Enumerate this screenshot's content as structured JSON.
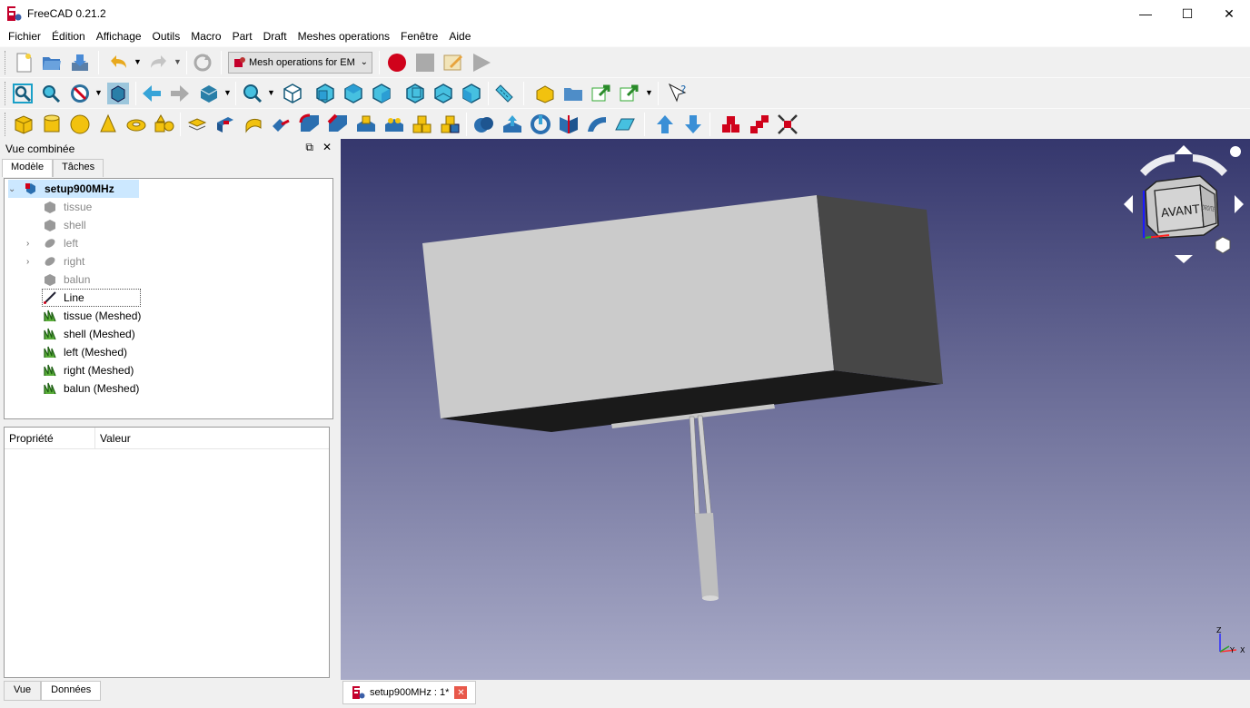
{
  "window": {
    "title": "FreeCAD 0.21.2",
    "min": "—",
    "max": "☐",
    "close": "✕"
  },
  "menu": [
    "Fichier",
    "Édition",
    "Affichage",
    "Outils",
    "Macro",
    "Part",
    "Draft",
    "Meshes operations",
    "Fenêtre",
    "Aide"
  ],
  "workbench": {
    "selected": "Mesh operations for EM"
  },
  "panel": {
    "title": "Vue combinée",
    "tabs": [
      "Modèle",
      "Tâches"
    ],
    "tree": [
      {
        "label": "setup900MHz",
        "kind": "doc"
      },
      {
        "label": "tissue",
        "kind": "box-hidden"
      },
      {
        "label": "shell",
        "kind": "box-hidden"
      },
      {
        "label": "left",
        "kind": "cyl-hidden",
        "expandable": true
      },
      {
        "label": "right",
        "kind": "cyl-hidden",
        "expandable": true
      },
      {
        "label": "balun",
        "kind": "box-hidden"
      },
      {
        "label": "Line",
        "kind": "line"
      },
      {
        "label": "tissue (Meshed)",
        "kind": "mesh"
      },
      {
        "label": "shell (Meshed)",
        "kind": "mesh"
      },
      {
        "label": "left (Meshed)",
        "kind": "mesh"
      },
      {
        "label": "right (Meshed)",
        "kind": "mesh"
      },
      {
        "label": "balun (Meshed)",
        "kind": "mesh"
      }
    ],
    "props_headers": [
      "Propriété",
      "Valeur"
    ],
    "bottom_tabs": [
      "Vue",
      "Données"
    ]
  },
  "navcube": {
    "face": "AVANT",
    "side": "DROITE"
  },
  "axes": {
    "x": "X",
    "y": "Y",
    "z": "Z"
  },
  "document_tab": {
    "label": "setup900MHz : 1*"
  }
}
